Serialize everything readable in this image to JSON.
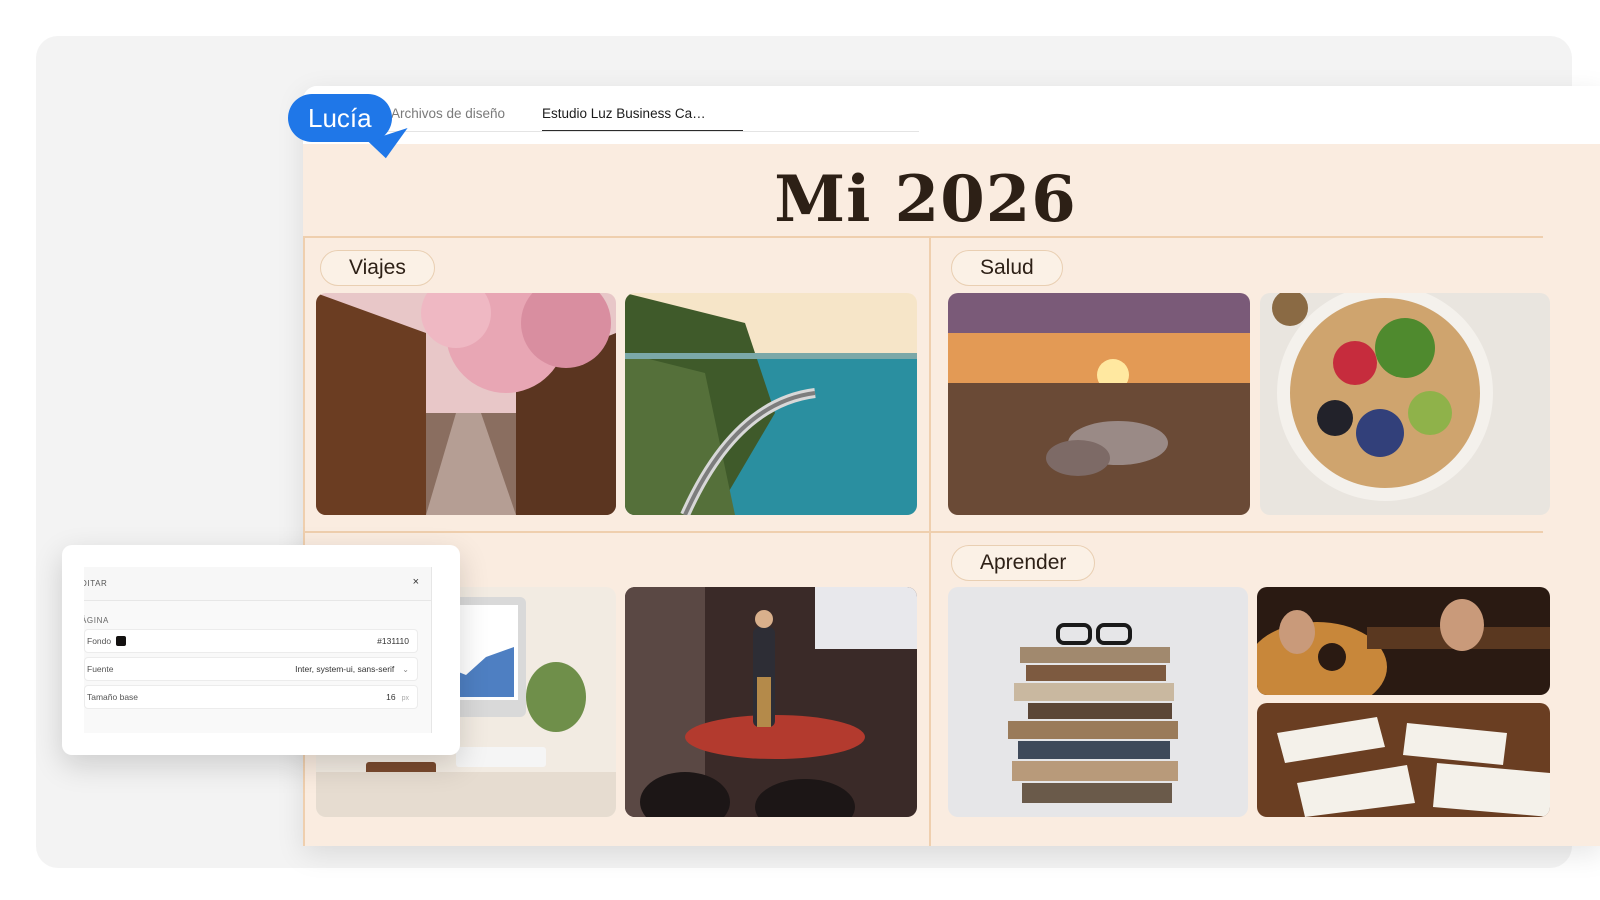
{
  "collaborator": {
    "name": "Lucía"
  },
  "tabs": [
    {
      "label": "Archivos de diseño",
      "active": false
    },
    {
      "label": "Estudio Luz Business Ca…",
      "active": true
    }
  ],
  "board": {
    "title": "Mi 2026",
    "sections": [
      {
        "label": "Viajes"
      },
      {
        "label": "Salud"
      },
      {
        "label": "Aprender"
      }
    ]
  },
  "edit_panel": {
    "title": "DITAR",
    "close": "×",
    "section": "ÁGINA",
    "fields": {
      "background": {
        "label": "Fondo",
        "value": "#131110"
      },
      "font": {
        "label": "Fuente",
        "value": "Inter, system-ui, sans-serif"
      },
      "base_size": {
        "label": "Tamaño base",
        "value": "16",
        "unit": "px"
      }
    }
  },
  "colors": {
    "accent_bubble": "#1f77e8",
    "board_background": "#faece0",
    "divider": "#efcfae",
    "swatch": "#131110"
  }
}
